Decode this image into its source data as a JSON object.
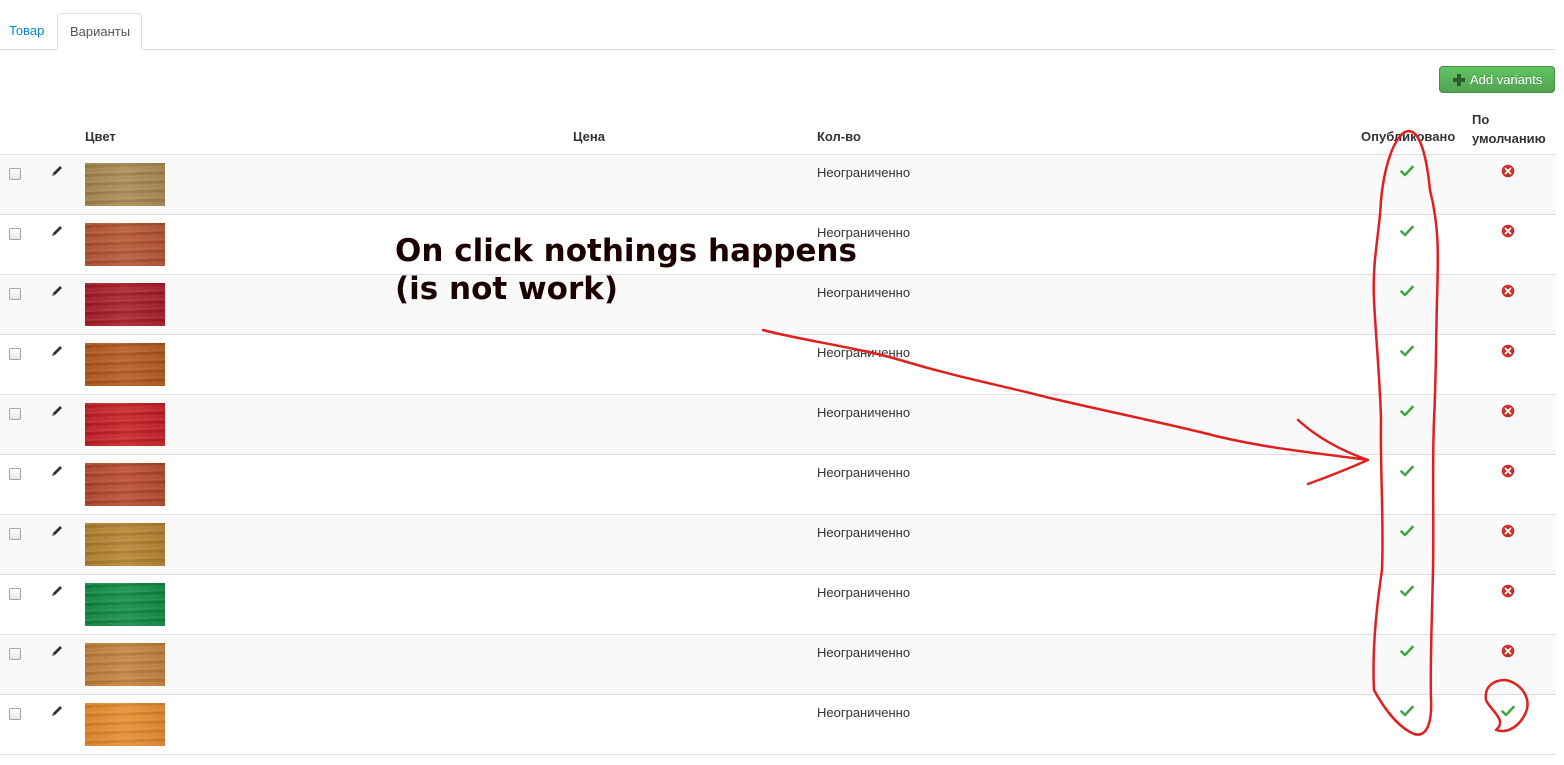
{
  "tabs": [
    {
      "label": "Товар",
      "active": false
    },
    {
      "label": "Варианты",
      "active": true
    }
  ],
  "toolbar": {
    "add_label": "Add variants"
  },
  "table": {
    "columns": {
      "color": "Цвет",
      "price": "Цена",
      "qty": "Кол-во",
      "published": "Опубликовано",
      "default_line1": "По",
      "default_line2": "умолчанию"
    },
    "rows": [
      {
        "swatch": "#a8894f",
        "qty": "Неограниченно",
        "published": true,
        "default": false
      },
      {
        "swatch": "#b5532f",
        "qty": "Неограниченно",
        "published": true,
        "default": false
      },
      {
        "swatch": "#a81a26",
        "qty": "Неограниченно",
        "published": true,
        "default": false
      },
      {
        "swatch": "#b3581c",
        "qty": "Неограниченно",
        "published": true,
        "default": false
      },
      {
        "swatch": "#c61e22",
        "qty": "Неограниченно",
        "published": true,
        "default": false
      },
      {
        "swatch": "#b8482a",
        "qty": "Неограниченно",
        "published": true,
        "default": false
      },
      {
        "swatch": "#b5812f",
        "qty": "Неограниченно",
        "published": true,
        "default": false
      },
      {
        "swatch": "#0f8a45",
        "qty": "Неограниченно",
        "published": true,
        "default": false
      },
      {
        "swatch": "#c2813a",
        "qty": "Неограниченно",
        "published": true,
        "default": false
      },
      {
        "swatch": "#e88a2a",
        "qty": "Неограниченно",
        "published": true,
        "default": true
      }
    ]
  },
  "annotation": {
    "line1": "On click nothings happens",
    "line2": "(is not work)",
    "color": "#e02020"
  },
  "colors": {
    "link": "#0088cc",
    "check": "#3fa547",
    "cross": "#c8302c",
    "button": "#51a351"
  }
}
